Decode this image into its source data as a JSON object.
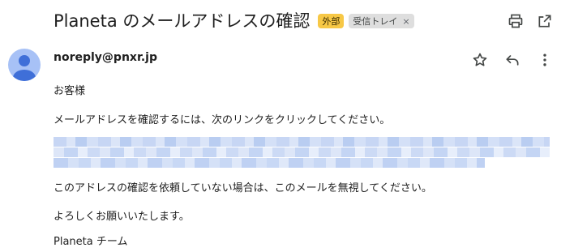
{
  "subject": "Planeta のメールアドレスの確認",
  "labels": {
    "external": "外部",
    "inbox": "受信トレイ",
    "inbox_remove": "×"
  },
  "top_actions": [
    "print-icon",
    "open-in-new-window-icon"
  ],
  "sender": {
    "address": "noreply@pnxr.jp",
    "avatar": "default-person-avatar"
  },
  "message_actions": [
    "star-icon",
    "reply-icon",
    "more-vertical-icon"
  ],
  "body": {
    "greeting": "お客様",
    "instruction": "メールアドレスを確認するには、次のリンクをクリックしてください。",
    "link_redacted": true,
    "ignore_notice": "このアドレスの確認を依頼していない場合は、このメールを無視してください。",
    "closing": "よろしくお願いいたします。",
    "signature": "Planeta チーム"
  },
  "colors": {
    "external_chip": "#f7c846",
    "inbox_chip": "#dedede",
    "avatar_bg": "#a7c1f6",
    "avatar_fg": "#3f6fd8",
    "blur_tint": "#c7d6f4"
  }
}
